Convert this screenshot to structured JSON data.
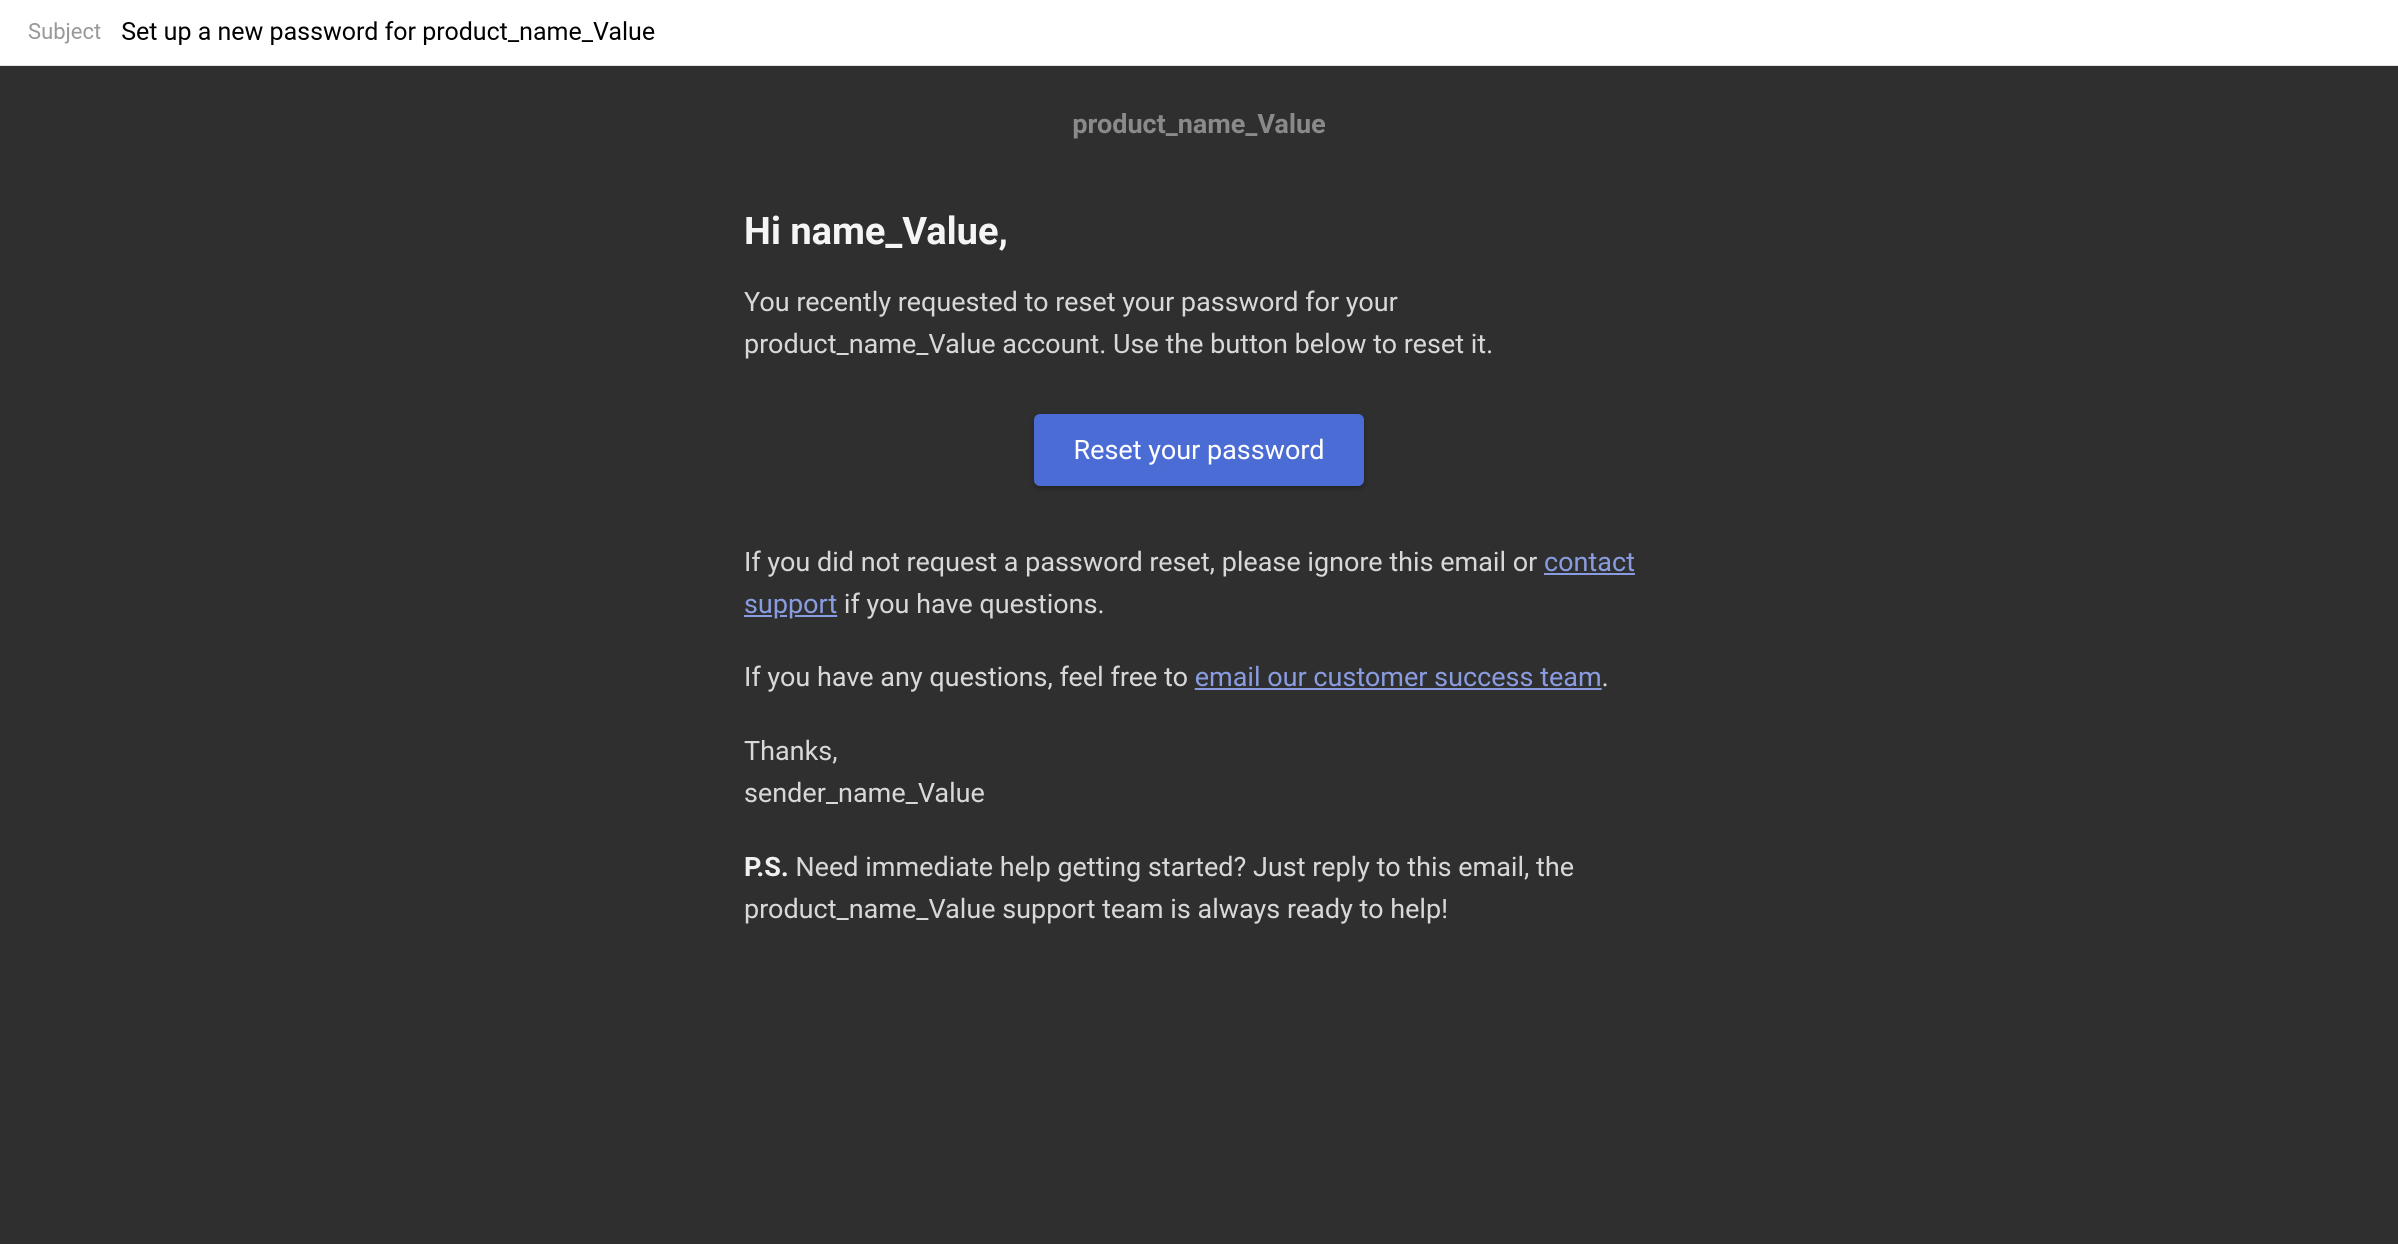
{
  "subject": {
    "label": "Subject",
    "value": "Set up a new password for product_name_Value"
  },
  "header": {
    "product_name": "product_name_Value"
  },
  "content": {
    "greeting": "Hi name_Value,",
    "intro": "You recently requested to reset your password for your product_name_Value account. Use the button below to reset it.",
    "button_label": "Reset your password",
    "ignore_pre": "If you did not request a password reset, please ignore this email or ",
    "contact_support_link": "contact support",
    "ignore_post": " if you have questions.",
    "questions_pre": "If you have any questions, feel free to ",
    "success_team_link": "email our customer success team",
    "questions_post": ".",
    "thanks": "Thanks,",
    "sender": "sender_name_Value",
    "ps_label": "P.S.",
    "ps_text": " Need immediate help getting started? Just reply to this email, the product_name_Value support team is always ready to help!"
  }
}
